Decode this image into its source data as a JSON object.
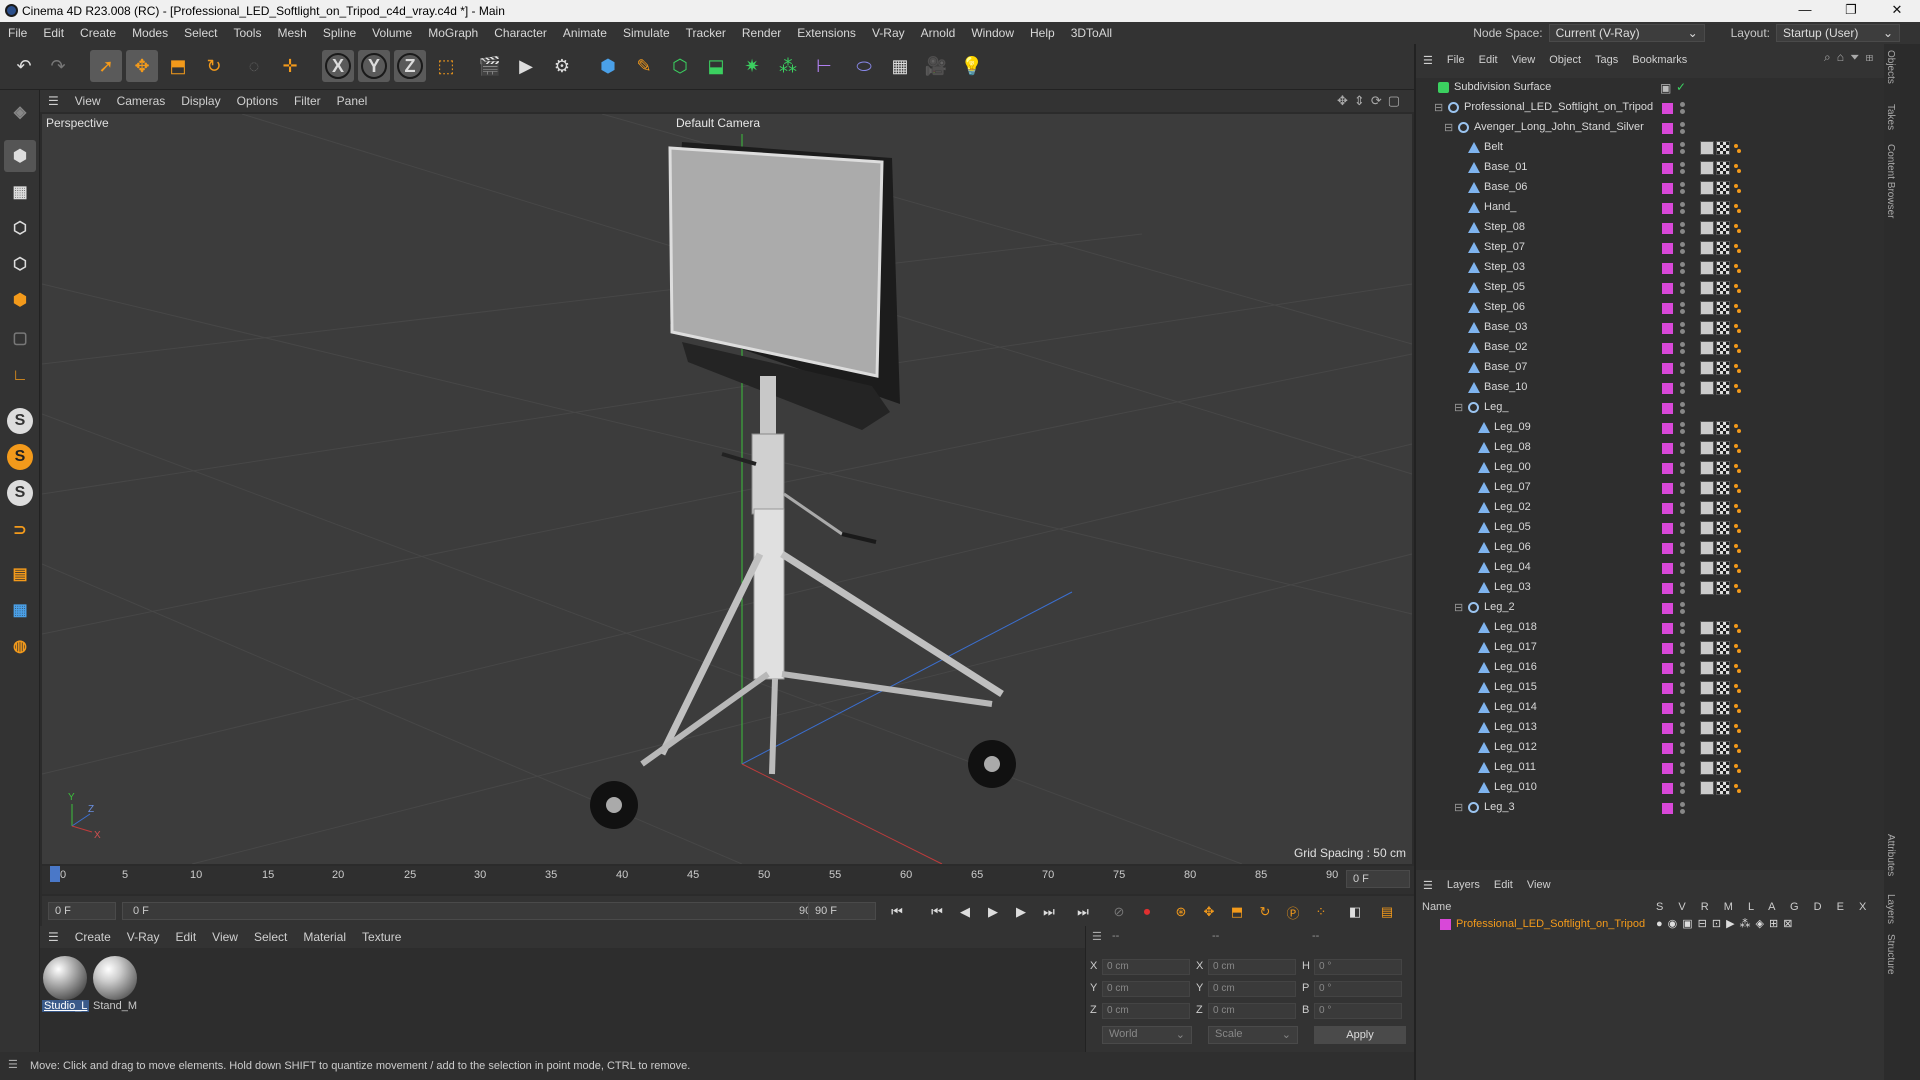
{
  "window": {
    "title": "Cinema 4D R23.008 (RC) - [Professional_LED_Softlight_on_Tripod_c4d_vray.c4d *] - Main",
    "controls": [
      "—",
      "❐",
      "✕"
    ]
  },
  "menubar": {
    "items": [
      "File",
      "Edit",
      "Create",
      "Modes",
      "Select",
      "Tools",
      "Mesh",
      "Spline",
      "Volume",
      "MoGraph",
      "Character",
      "Animate",
      "Simulate",
      "Tracker",
      "Render",
      "Extensions",
      "V-Ray",
      "Arnold",
      "Window",
      "Help",
      "3DToAll"
    ],
    "node_space_label": "Node Space:",
    "node_space_value": "Current (V-Ray)",
    "layout_label": "Layout:",
    "layout_value": "Startup (User)"
  },
  "viewport": {
    "menu": [
      "View",
      "Cameras",
      "Display",
      "Options",
      "Filter",
      "Panel"
    ],
    "label": "Perspective",
    "camera": "Default Camera",
    "grid_spacing": "Grid Spacing : 50 cm"
  },
  "timeline": {
    "ticks": [
      "0",
      "5",
      "10",
      "15",
      "20",
      "25",
      "30",
      "35",
      "40",
      "45",
      "50",
      "55",
      "60",
      "65",
      "70",
      "75",
      "80",
      "85",
      "90"
    ],
    "current_frame": "0 F",
    "start": "0 F",
    "range_start": "0 F",
    "range_end": "90 F",
    "end": "90 F"
  },
  "material_manager": {
    "menu": [
      "Create",
      "V-Ray",
      "Edit",
      "View",
      "Select",
      "Material",
      "Texture"
    ],
    "materials": [
      {
        "name": "Studio_L"
      },
      {
        "name": "Stand_M"
      }
    ]
  },
  "coords": {
    "headers": [
      "--",
      "--",
      "--"
    ],
    "rows": [
      {
        "a_label": "X",
        "a_val": "0 cm",
        "b_label": "X",
        "b_val": "0 cm",
        "c_label": "H",
        "c_val": "0 °"
      },
      {
        "a_label": "Y",
        "a_val": "0 cm",
        "b_label": "Y",
        "b_val": "0 cm",
        "c_label": "P",
        "c_val": "0 °"
      },
      {
        "a_label": "Z",
        "a_val": "0 cm",
        "b_label": "Z",
        "b_val": "0 cm",
        "c_label": "B",
        "c_val": "0 °"
      }
    ],
    "mode1": "World",
    "mode2": "Scale",
    "apply": "Apply"
  },
  "status": "Move: Click and drag to move elements. Hold down SHIFT to quantize movement / add to the selection in point mode, CTRL to remove.",
  "object_manager": {
    "menu": [
      "File",
      "Edit",
      "View",
      "Object",
      "Tags",
      "Bookmarks"
    ],
    "objects": [
      {
        "name": "Subdivision Surface",
        "level": 0,
        "tags": false,
        "swatch": false,
        "kind": "subd"
      },
      {
        "name": "Professional_LED_Softlight_on_Tripod",
        "level": 1,
        "tags": false,
        "swatch": true,
        "kind": "null"
      },
      {
        "name": "Avenger_Long_John_Stand_Silver",
        "level": 2,
        "tags": false,
        "swatch": true,
        "kind": "null"
      },
      {
        "name": "Belt",
        "level": 3,
        "tags": true,
        "swatch": true,
        "kind": "poly"
      },
      {
        "name": "Base_01",
        "level": 3,
        "tags": true,
        "swatch": true,
        "kind": "poly"
      },
      {
        "name": "Base_06",
        "level": 3,
        "tags": true,
        "swatch": true,
        "kind": "poly"
      },
      {
        "name": "Hand_",
        "level": 3,
        "tags": true,
        "swatch": true,
        "kind": "poly"
      },
      {
        "name": "Step_08",
        "level": 3,
        "tags": true,
        "swatch": true,
        "kind": "poly"
      },
      {
        "name": "Step_07",
        "level": 3,
        "tags": true,
        "swatch": true,
        "kind": "poly"
      },
      {
        "name": "Step_03",
        "level": 3,
        "tags": true,
        "swatch": true,
        "kind": "poly"
      },
      {
        "name": "Step_05",
        "level": 3,
        "tags": true,
        "swatch": true,
        "kind": "poly"
      },
      {
        "name": "Step_06",
        "level": 3,
        "tags": true,
        "swatch": true,
        "kind": "poly"
      },
      {
        "name": "Base_03",
        "level": 3,
        "tags": true,
        "swatch": true,
        "kind": "poly"
      },
      {
        "name": "Base_02",
        "level": 3,
        "tags": true,
        "swatch": true,
        "kind": "poly"
      },
      {
        "name": "Base_07",
        "level": 3,
        "tags": true,
        "swatch": true,
        "kind": "poly"
      },
      {
        "name": "Base_10",
        "level": 3,
        "tags": true,
        "swatch": true,
        "kind": "poly"
      },
      {
        "name": "Leg_",
        "level": 3,
        "tags": false,
        "swatch": true,
        "kind": "null"
      },
      {
        "name": "Leg_09",
        "level": 4,
        "tags": true,
        "swatch": true,
        "kind": "poly"
      },
      {
        "name": "Leg_08",
        "level": 4,
        "tags": true,
        "swatch": true,
        "kind": "poly"
      },
      {
        "name": "Leg_00",
        "level": 4,
        "tags": true,
        "swatch": true,
        "kind": "poly"
      },
      {
        "name": "Leg_07",
        "level": 4,
        "tags": true,
        "swatch": true,
        "kind": "poly"
      },
      {
        "name": "Leg_02",
        "level": 4,
        "tags": true,
        "swatch": true,
        "kind": "poly"
      },
      {
        "name": "Leg_05",
        "level": 4,
        "tags": true,
        "swatch": true,
        "kind": "poly"
      },
      {
        "name": "Leg_06",
        "level": 4,
        "tags": true,
        "swatch": true,
        "kind": "poly"
      },
      {
        "name": "Leg_04",
        "level": 4,
        "tags": true,
        "swatch": true,
        "kind": "poly"
      },
      {
        "name": "Leg_03",
        "level": 4,
        "tags": true,
        "swatch": true,
        "kind": "poly"
      },
      {
        "name": "Leg_2",
        "level": 3,
        "tags": false,
        "swatch": true,
        "kind": "null"
      },
      {
        "name": "Leg_018",
        "level": 4,
        "tags": true,
        "swatch": true,
        "kind": "poly"
      },
      {
        "name": "Leg_017",
        "level": 4,
        "tags": true,
        "swatch": true,
        "kind": "poly"
      },
      {
        "name": "Leg_016",
        "level": 4,
        "tags": true,
        "swatch": true,
        "kind": "poly"
      },
      {
        "name": "Leg_015",
        "level": 4,
        "tags": true,
        "swatch": true,
        "kind": "poly"
      },
      {
        "name": "Leg_014",
        "level": 4,
        "tags": true,
        "swatch": true,
        "kind": "poly"
      },
      {
        "name": "Leg_013",
        "level": 4,
        "tags": true,
        "swatch": true,
        "kind": "poly"
      },
      {
        "name": "Leg_012",
        "level": 4,
        "tags": true,
        "swatch": true,
        "kind": "poly"
      },
      {
        "name": "Leg_011",
        "level": 4,
        "tags": true,
        "swatch": true,
        "kind": "poly"
      },
      {
        "name": "Leg_010",
        "level": 4,
        "tags": true,
        "swatch": true,
        "kind": "poly"
      },
      {
        "name": "Leg_3",
        "level": 3,
        "tags": false,
        "swatch": true,
        "kind": "null"
      }
    ]
  },
  "layers": {
    "menu": [
      "Layers",
      "Edit",
      "View"
    ],
    "name_header": "Name",
    "columns": [
      "S",
      "V",
      "R",
      "M",
      "L",
      "A",
      "G",
      "D",
      "E",
      "X"
    ],
    "layer_name": "Professional_LED_Softlight_on_Tripod"
  },
  "side_tabs": [
    "Objects",
    "Takes",
    "Content Browser",
    "Attributes",
    "Layers",
    "Structure"
  ],
  "colors": {
    "accent_orange": "#f39a1b",
    "layer_magenta": "#d848d8",
    "axis_green": "#3bbf3b",
    "axis_red": "#c03b3b",
    "axis_blue": "#3b6fd0"
  }
}
